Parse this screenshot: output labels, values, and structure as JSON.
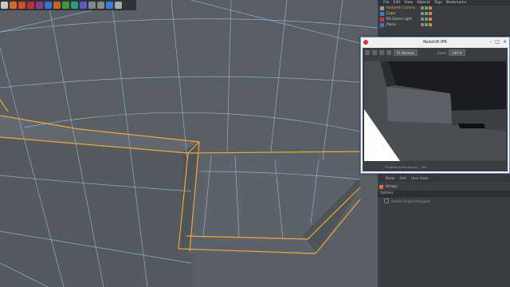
{
  "viewport": {
    "toolbar_icons": [
      {
        "name": "knife-tool-icon",
        "color": "#c9c9c9"
      },
      {
        "name": "tool-icon-2",
        "color": "#d86a2c"
      },
      {
        "name": "tool-icon-3",
        "color": "#d84a2c"
      },
      {
        "name": "tool-icon-4",
        "color": "#c03030"
      },
      {
        "name": "tool-icon-5",
        "color": "#8a3a8a"
      },
      {
        "name": "cube-icon",
        "color": "#3a6fd8"
      },
      {
        "name": "pen-icon",
        "color": "#c06a20"
      },
      {
        "name": "subdivide-icon",
        "color": "#3a9a3a"
      },
      {
        "name": "array-icon",
        "color": "#2aa07a"
      },
      {
        "name": "deformer-icon",
        "color": "#5a5acd"
      },
      {
        "name": "floor-icon",
        "color": "#888"
      },
      {
        "name": "camera-icon",
        "color": "#888"
      },
      {
        "name": "grid-icon",
        "color": "#3a7ad8"
      },
      {
        "name": "light-icon",
        "color": "#aaa"
      }
    ]
  },
  "object_manager": {
    "menu": [
      "File",
      "Edit",
      "View",
      "Objects",
      "Tags",
      "Bookmarks"
    ],
    "objects": [
      {
        "name": "Redshift Camera",
        "color": "#e0a040",
        "icon_color": "#999",
        "selected": false
      },
      {
        "name": "Cube",
        "color": "#f0c040",
        "icon_color": "#3a7ad8",
        "selected": false
      },
      {
        "name": "RS Dome Light",
        "color": "#c9ccd0",
        "icon_color": "#d33",
        "selected": false
      },
      {
        "name": "Plane",
        "color": "#c9ccd0",
        "icon_color": "#3a7ad8",
        "selected": false
      }
    ]
  },
  "attribute_manager": {
    "menu": [
      "Mode",
      "Edit",
      "User Data"
    ],
    "tool_name": "Bridge",
    "tab": "Options",
    "option_label": "Delete Original Polygons"
  },
  "ipr": {
    "title": "Redshift IPR",
    "channel": "Fit Window",
    "zoom_label": "Zoom",
    "zoom_value": "100 %",
    "status": "Progressive Rendering... 13%"
  },
  "colors": {
    "accent_selection": "#f2a830",
    "grid_line": "#8fb8d8"
  }
}
